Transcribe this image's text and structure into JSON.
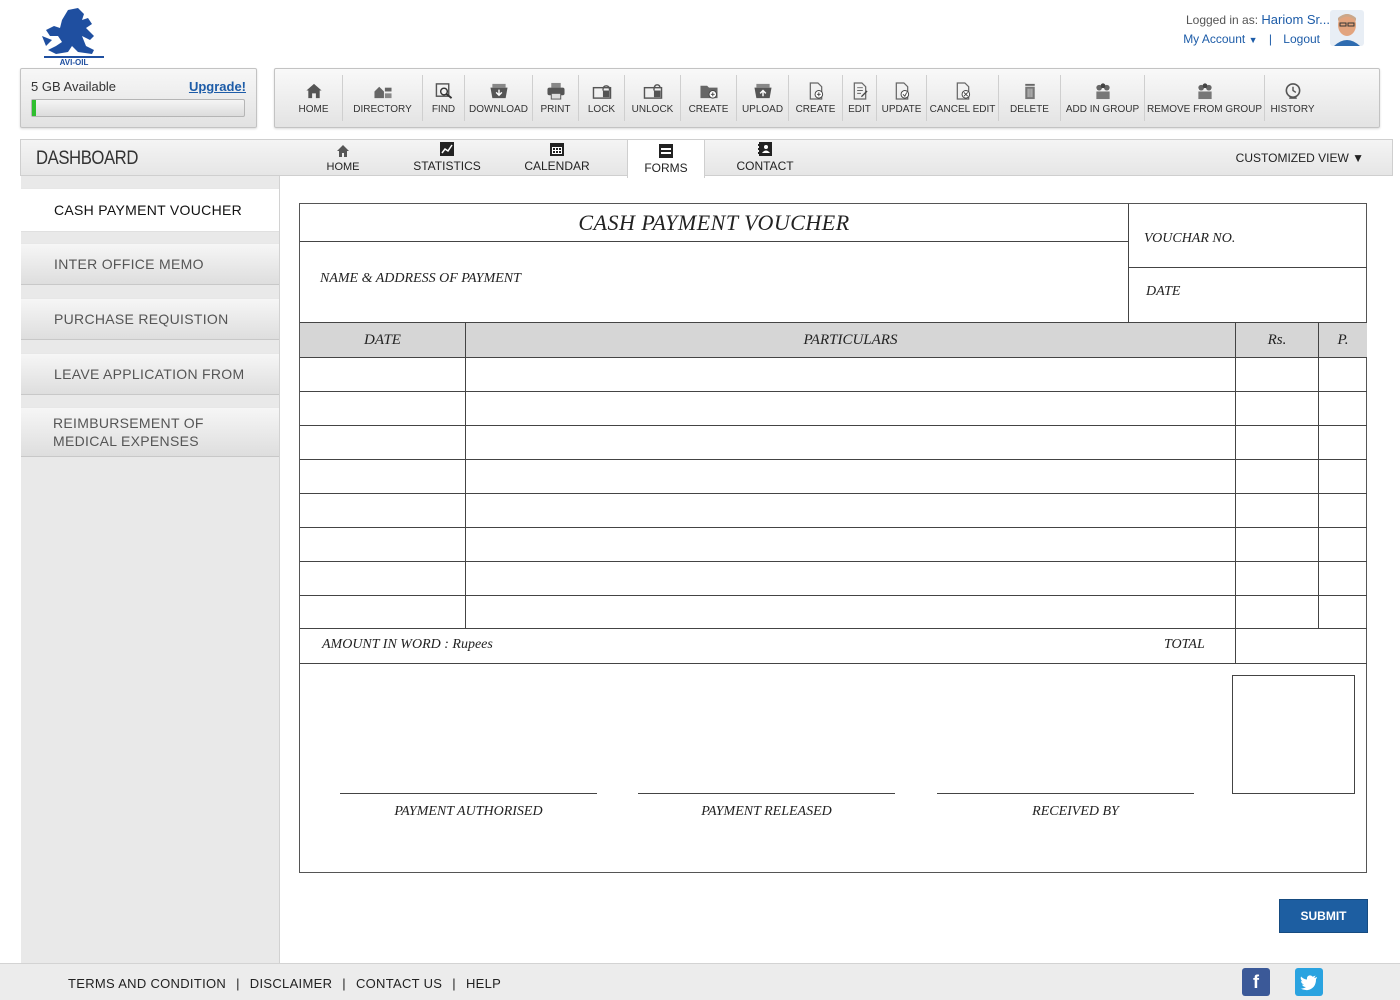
{
  "brand": {
    "logo_text": "AVI-OIL",
    "logo_color": "#1f4fa0"
  },
  "user": {
    "logged_in_label": "Logged in as:",
    "name": "Hariom Sr...",
    "my_account": "My Account",
    "separator": "|",
    "logout": "Logout"
  },
  "storage": {
    "available": "5 GB Available",
    "upgrade": "Upgrade!",
    "used_fraction": 0.02
  },
  "toolbar": [
    {
      "label": "HOME",
      "icon": "home-icon"
    },
    {
      "label": "DIRECTORY",
      "icon": "directory-icon"
    },
    {
      "label": "FIND",
      "icon": "find-icon"
    },
    {
      "label": "DOWNLOAD",
      "icon": "download-icon"
    },
    {
      "label": "PRINT",
      "icon": "print-icon"
    },
    {
      "label": "LOCK",
      "icon": "lock-icon"
    },
    {
      "label": "UNLOCK",
      "icon": "unlock-icon"
    },
    {
      "label": "CREATE",
      "icon": "create-folder-icon"
    },
    {
      "label": "UPLOAD",
      "icon": "upload-icon"
    },
    {
      "label": "CREATE",
      "icon": "create-file-icon"
    },
    {
      "label": "EDIT",
      "icon": "edit-icon"
    },
    {
      "label": "UPDATE",
      "icon": "update-icon"
    },
    {
      "label": "CANCEL EDIT",
      "icon": "cancel-edit-icon"
    },
    {
      "label": "DELETE",
      "icon": "delete-icon"
    },
    {
      "label": "ADD IN GROUP",
      "icon": "add-group-icon"
    },
    {
      "label": "REMOVE FROM GROUP",
      "icon": "remove-group-icon"
    },
    {
      "label": "HISTORY",
      "icon": "history-icon"
    }
  ],
  "tabs": {
    "title": "DASHBOARD",
    "home": "HOME",
    "statistics": "STATISTICS",
    "calendar": "CALENDAR",
    "forms": "FORMS",
    "contact": "CONTACT",
    "customized_view": "CUSTOMIZED VIEW ▼",
    "active": "FORMS"
  },
  "sidebar": {
    "items": [
      "CASH PAYMENT VOUCHER",
      "INTER OFFICE MEMO",
      "PURCHASE REQUISTION",
      "LEAVE APPLICATION FROM",
      "REIMBURSEMENT OF MEDICAL EXPENSES"
    ],
    "active": "CASH PAYMENT VOUCHER"
  },
  "voucher": {
    "title": "CASH PAYMENT VOUCHER",
    "voucher_no": "VOUCHAR NO.",
    "name_address": "NAME & ADDRESS OF PAYMENT",
    "date": "DATE",
    "columns": [
      "DATE",
      "PARTICULARS",
      "Rs.",
      "P."
    ],
    "row_count": 8,
    "amount_in_word": "AMOUNT IN WORD : Rupees",
    "total": "TOTAL",
    "signatures": [
      "PAYMENT AUTHORISED",
      "PAYMENT RELEASED",
      "RECEIVED BY"
    ]
  },
  "submit": "SUBMIT",
  "footer": {
    "links": [
      "TERMS AND CONDITION",
      "DISCLAIMER",
      "CONTACT US",
      "HELP"
    ],
    "separator": "|",
    "facebook_icon": "facebook-icon",
    "twitter_icon": "twitter-icon",
    "facebook_color": "#3b5998",
    "twitter_color": "#2aa3e0"
  }
}
